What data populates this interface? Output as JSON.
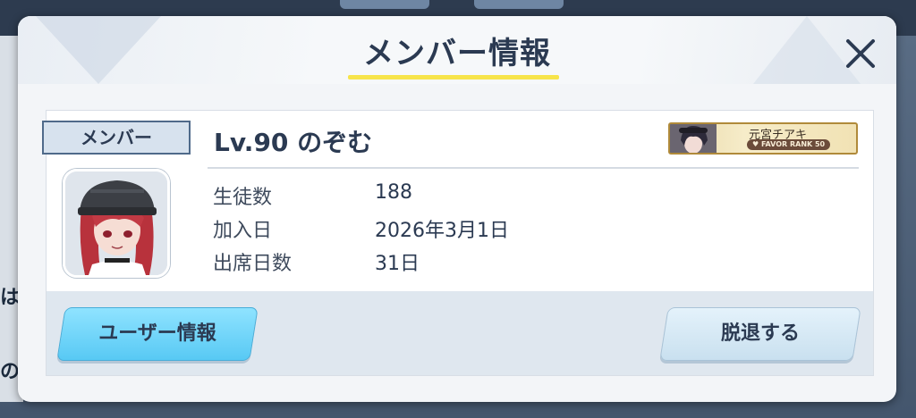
{
  "background": {
    "left_text_1": "は",
    "left_text_2": "の"
  },
  "dialog": {
    "title": "メンバー情報",
    "close_icon": "close-icon"
  },
  "member": {
    "role": "メンバー",
    "name": "Lv.90 のぞむ",
    "favorite": {
      "character": "元宮チアキ",
      "rank_label": "FAVOR RANK 50"
    },
    "stats": [
      {
        "label": "生徒数",
        "value": "188"
      },
      {
        "label": "加入日",
        "value": "2026年3月1日"
      },
      {
        "label": "出席日数",
        "value": "31日"
      }
    ]
  },
  "actions": {
    "user_info": "ユーザー情報",
    "leave": "脱退する"
  },
  "colors": {
    "accent_underline": "#f7e44a",
    "primary_button": "#58c9f4",
    "title_text": "#2b3a52"
  }
}
